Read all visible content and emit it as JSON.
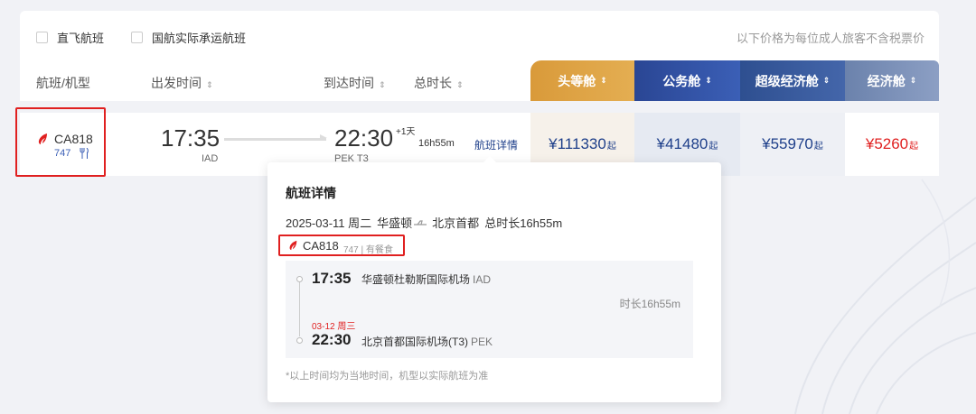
{
  "filters": {
    "direct_only": "直飞航班",
    "ca_operated": "国航实际承运航班",
    "price_note": "以下价格为每位成人旅客不含税票价"
  },
  "columns": {
    "flight": "航班/机型",
    "departure": "出发时间",
    "arrival": "到达时间",
    "duration": "总时长",
    "sort_symbol": "⇕"
  },
  "cabins": {
    "first": "头等舱",
    "business": "公务舱",
    "premium": "超级经济舱",
    "economy": "经济舱"
  },
  "flight": {
    "number": "CA818",
    "aircraft": "747",
    "dep_time": "17:35",
    "dep_airport": "IAD",
    "arr_time": "22:30",
    "plus_day": "+1天",
    "arr_airport": "PEK T3",
    "duration": "16h55m",
    "detail_link": "航班详情",
    "prices": {
      "first": "¥111330",
      "business": "¥41480",
      "premium": "¥55970",
      "economy": "¥5260",
      "suffix": "起"
    }
  },
  "popup": {
    "title": "航班详情",
    "date": "2025-03-11 周二",
    "origin_city": "华盛顿",
    "dest_city": "北京首都",
    "total_duration": "总时长16h55m",
    "flight_no": "CA818",
    "flight_sub": "747 | 有餐食",
    "dep_time": "17:35",
    "dep_airport": "华盛顿杜勒斯国际机场",
    "dep_code": "IAD",
    "segment_duration": "时长16h55m",
    "arr_date": "03-12 周三",
    "arr_time": "22:30",
    "arr_airport": "北京首都国际机场(T3)",
    "arr_code": "PEK",
    "note": "*以上时间均为当地时间，机型以实际航班为准"
  },
  "colors": {
    "brand_red": "#e02020",
    "brand_blue": "#1e3f8a",
    "first_gold": "#d99a3a"
  },
  "icons": {
    "airline": "air-china-phoenix-icon",
    "meal": "meal-utensils-icon",
    "sort": "sort-icon",
    "checkbox": "checkbox-icon",
    "route_plane": "plane-icon"
  }
}
